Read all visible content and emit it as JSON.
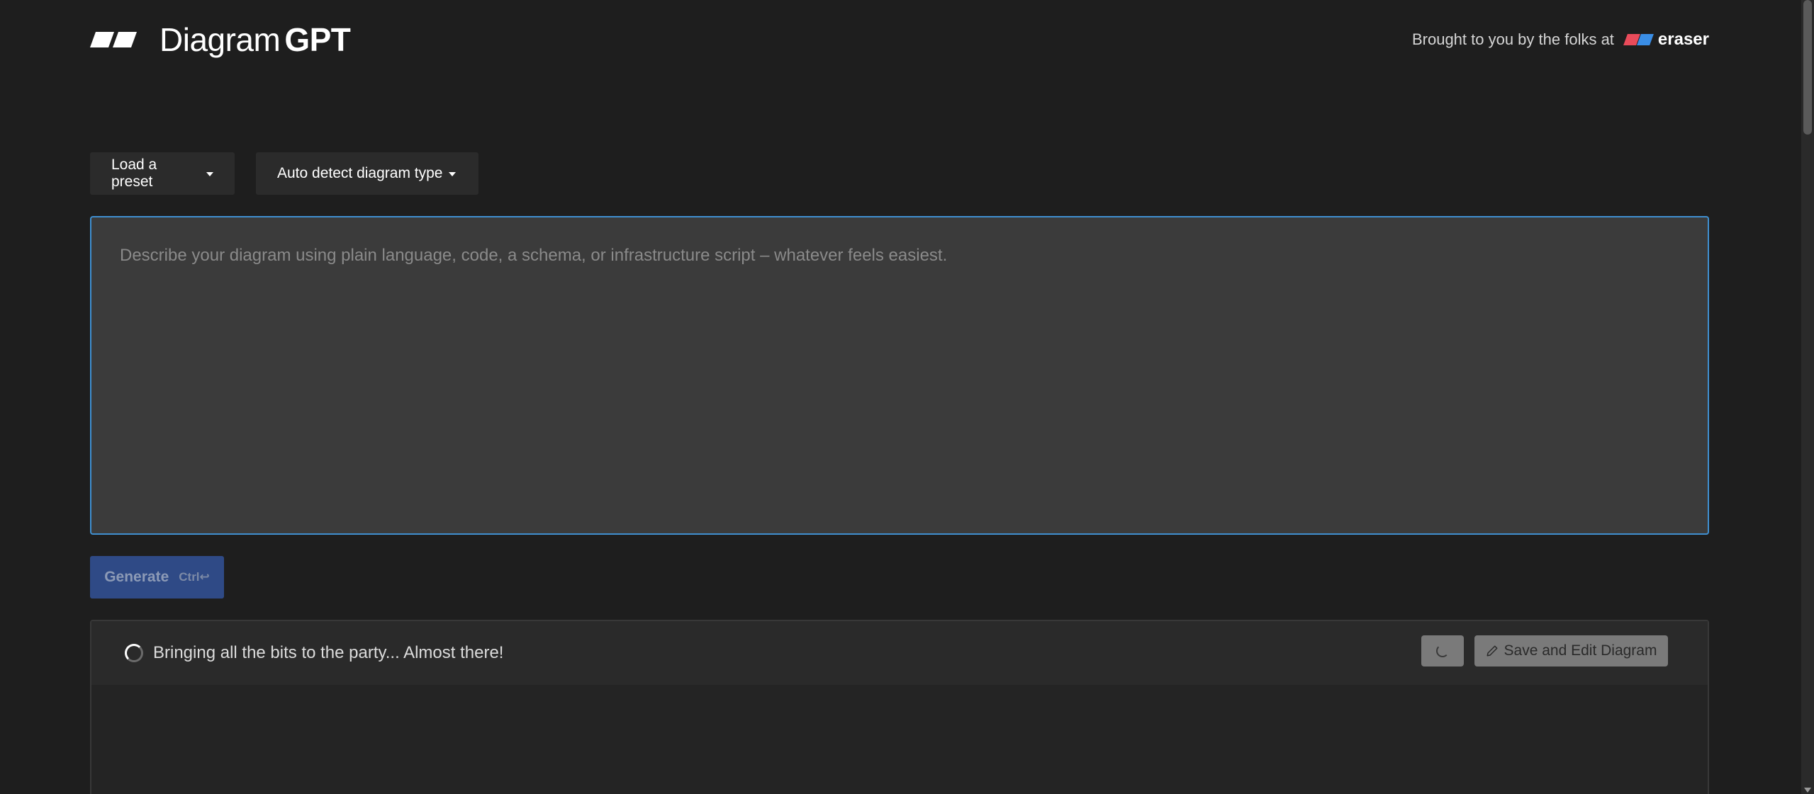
{
  "brand": {
    "name_light": "Diagram",
    "name_bold": "GPT",
    "logo_icon": "diagramgpt-logo-icon"
  },
  "credit": {
    "text": "Brought to you by the folks at",
    "partner_name": "eraser",
    "partner_colors": [
      "#e94b5a",
      "#3a8ee6"
    ]
  },
  "controls": {
    "preset_label": "Load a preset",
    "diagram_type_label": "Auto detect diagram type"
  },
  "prompt": {
    "value": "",
    "placeholder": "Describe your diagram using plain language, code, a schema, or infrastructure script – whatever feels easiest."
  },
  "generate": {
    "label": "Generate",
    "shortcut": "Ctrl↩"
  },
  "result": {
    "status_text": "Bringing all the bits to the party... Almost there!",
    "save_label": "Save and Edit Diagram"
  },
  "colors": {
    "background": "#1e1e1e",
    "accent_border": "#3f8fd0",
    "generate_button": "#2f4a86"
  }
}
